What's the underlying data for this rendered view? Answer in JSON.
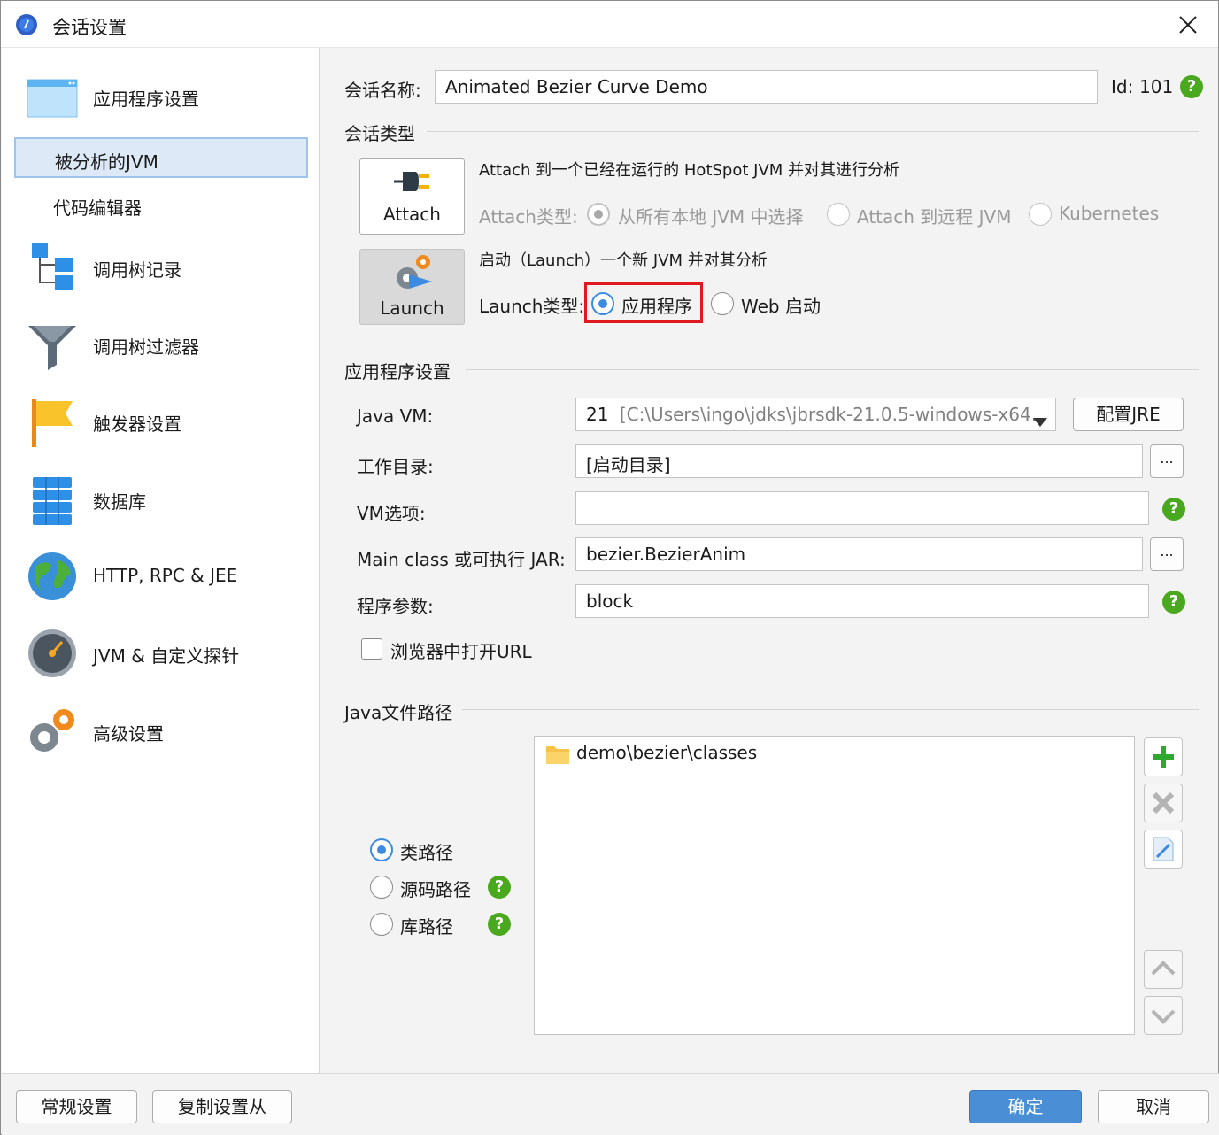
{
  "window": {
    "title": "会话设置"
  },
  "sidebar": {
    "items": [
      {
        "label": "应用程序设置",
        "icon": "app-settings-icon"
      },
      {
        "label": "被分析的JVM",
        "selected": true
      },
      {
        "label": "代码编辑器"
      },
      {
        "label": "调用树记录",
        "icon": "call-tree-icon"
      },
      {
        "label": "调用树过滤器",
        "icon": "filter-icon"
      },
      {
        "label": "触发器设置",
        "icon": "flag-icon"
      },
      {
        "label": "数据库",
        "icon": "database-icon"
      },
      {
        "label": "HTTP, RPC & JEE",
        "icon": "globe-icon"
      },
      {
        "label": "JVM & 自定义探针",
        "icon": "gauge-icon"
      },
      {
        "label": "高级设置",
        "icon": "gears-icon"
      }
    ]
  },
  "session": {
    "name_label": "会话名称:",
    "name_value": "Animated Bezier Curve Demo",
    "id_label": "Id:",
    "id_value": "101"
  },
  "session_type": {
    "title": "会话类型",
    "attach_button": "Attach",
    "attach_desc": "Attach 到一个已经在运行的 HotSpot JVM 并对其进行分析",
    "attach_type_label": "Attach类型:",
    "attach_options": [
      "从所有本地 JVM 中选择",
      "Attach 到远程 JVM",
      "Kubernetes"
    ],
    "launch_button": "Launch",
    "launch_desc": "启动（Launch）一个新 JVM 并对其分析",
    "launch_type_label": "Launch类型:",
    "launch_options": [
      "应用程序",
      "Web 启动"
    ],
    "highlight_color": "#e0191f"
  },
  "app_settings": {
    "title": "应用程序设置",
    "java_vm_label": "Java VM:",
    "java_vm_version": "21",
    "java_vm_path": "[C:\\Users\\ingo\\jdks\\jbrsdk-21.0.5-windows-x64...",
    "config_jre_button": "配置JRE",
    "workdir_label": "工作目录:",
    "workdir_value": "[启动目录]",
    "vm_options_label": "VM选项:",
    "vm_options_value": "",
    "main_class_label": "Main class 或可执行 JAR:",
    "main_class_value": "bezier.BezierAnim",
    "args_label": "程序参数:",
    "args_value": "block",
    "browse_label": "...",
    "open_url_label": "浏览器中打开URL"
  },
  "java_paths": {
    "title": "Java文件路径",
    "path_types": [
      "类路径",
      "源码路径",
      "库路径"
    ],
    "entries": [
      "demo\\bezier\\classes"
    ]
  },
  "footer": {
    "general_button": "常规设置",
    "copy_button": "复制设置从",
    "ok_button": "确定",
    "cancel_button": "取消",
    "accent": "#4a8fd6"
  }
}
